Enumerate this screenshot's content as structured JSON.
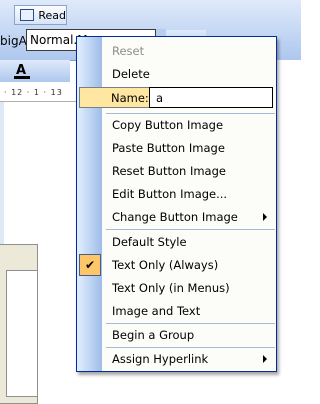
{
  "toolbar": {
    "read_label": "Read",
    "style_left_text": "bigA",
    "style_box_value": "Normal.M",
    "font_color_glyph": "A",
    "ruler_text": "· 12 · 1 · 13"
  },
  "menu": {
    "reset": "Reset",
    "delete": "Delete",
    "name_label": "Name:",
    "name_value": "a",
    "copy_image": "Copy Button Image",
    "paste_image": "Paste Button Image",
    "reset_image": "Reset Button Image",
    "edit_image": "Edit Button Image...",
    "change_image": "Change Button Image",
    "default_style": "Default Style",
    "text_only_always": "Text Only (Always)",
    "text_only_menus": "Text Only (in Menus)",
    "image_and_text": "Image and Text",
    "begin_group": "Begin a Group",
    "assign_hyperlink": "Assign Hyperlink"
  },
  "icons": {
    "check": "check-icon",
    "submenu_arrow": "chevron-right-icon"
  },
  "colors": {
    "menu_border": "#002d96",
    "highlight": "#ffc669",
    "name_highlight": "#ffe7a2",
    "stripe_light": "#e3efff",
    "stripe_dark": "#9ebde8",
    "disabled_text": "#8d8d8d"
  }
}
